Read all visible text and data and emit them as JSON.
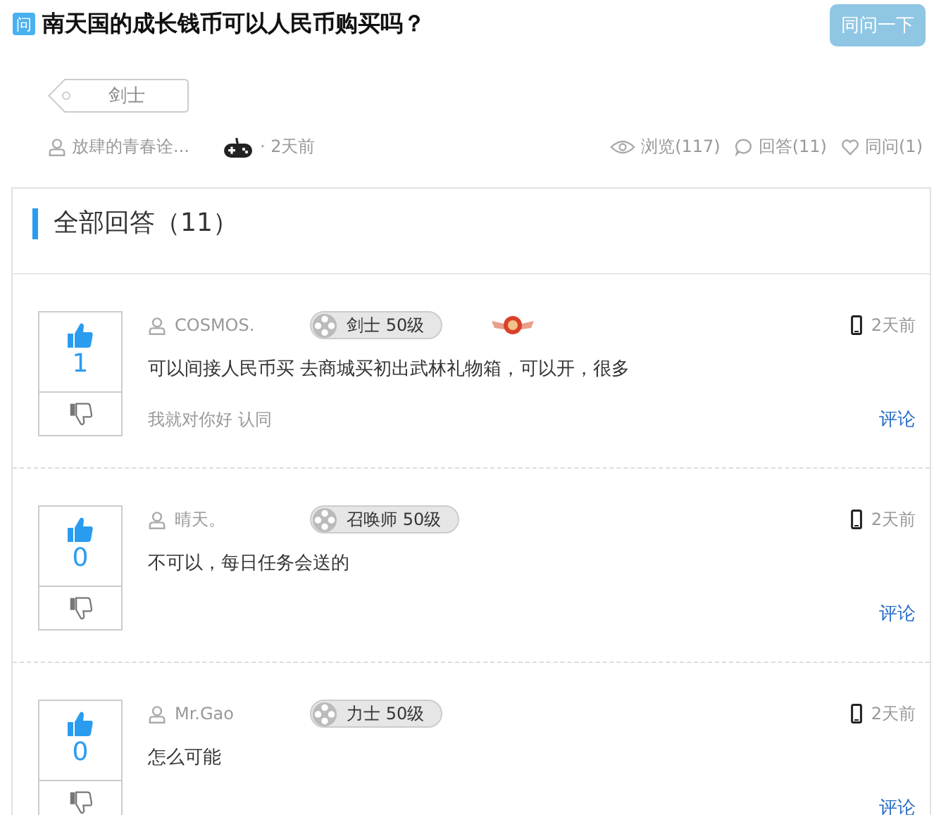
{
  "question": {
    "badge": "问",
    "title": "南天国的成长钱币可以人民币购买吗？",
    "button": "同问一下"
  },
  "tags": [
    "剑士"
  ],
  "meta": {
    "author": "放肆的青春诠...",
    "time": "· 2天前",
    "views": "浏览(117)",
    "answers": "回答(11)",
    "same": "同问(1)"
  },
  "answers_header": "全部回答（11）",
  "answers": [
    {
      "votes": "1",
      "user": "COSMOS.",
      "rank": "剑士 50级",
      "medal": true,
      "time": "2天前",
      "text": "可以间接人民币买 去商城买初出武林礼物箱，可以开，很多",
      "endorse": "我就对你好 认同",
      "comment": "评论"
    },
    {
      "votes": "0",
      "user": "晴天。",
      "rank": "召唤师 50级",
      "medal": false,
      "time": "2天前",
      "text": "不可以，每日任务会送的",
      "comment": "评论"
    },
    {
      "votes": "0",
      "user": "Mr.Gao",
      "rank": "力士 50级",
      "medal": false,
      "time": "2天前",
      "text": "怎么可能",
      "comment": "评论"
    }
  ]
}
